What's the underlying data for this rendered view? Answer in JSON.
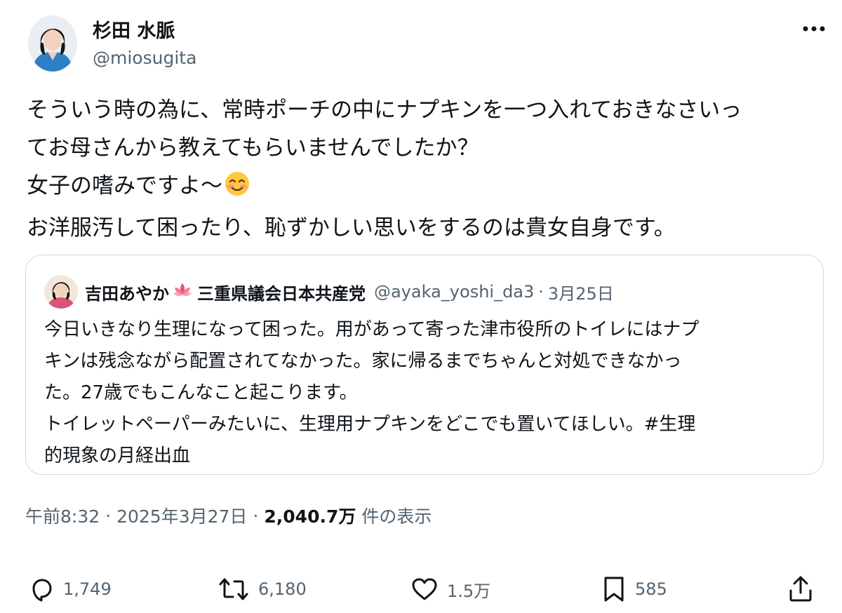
{
  "author": {
    "name": "杉田 水脈",
    "handle": "@miosugita"
  },
  "tweet": {
    "lines": [
      "そういう時の為に、常時ポーチの中にナプキンを一つ入れておきなさいっ",
      "てお母さんから教えてもらいませんでしたか？",
      "女子の嗜みですよ〜",
      "お洋服汚して困ったり、恥ずかしい思いをするのは貴女自身です。"
    ],
    "emoji": "smiling-face-with-smiling-eyes"
  },
  "quote": {
    "author_name": "吉田あやか",
    "author_name_rest": "三重県議会日本共産党",
    "handle": "@ayaka_yoshi_da3",
    "separator": "·",
    "date": "3月25日",
    "lines": [
      "今日いきなり生理になって困った。用があって寄った津市役所のトイレにはナプ",
      "キンは残念ながら配置されてなかった。家に帰るまでちゃんと対処できなかっ",
      "た。27歳でもこんなこと起こります。",
      "トイレットペーパーみたいに、生理用ナプキンをどこでも置いてほしい。#生理",
      "的現象の月経出血"
    ]
  },
  "meta": {
    "time": "午前8:32",
    "separator": "·",
    "date": "2025年3月27日",
    "views": "2,040.7万",
    "views_label": "件の表示"
  },
  "actions": {
    "replies": "1,749",
    "reposts": "6,180",
    "likes": "1.5万",
    "bookmarks": "585"
  },
  "colors": {
    "text": "#0f1419",
    "secondary": "#536471",
    "border": "#cfd9de"
  }
}
